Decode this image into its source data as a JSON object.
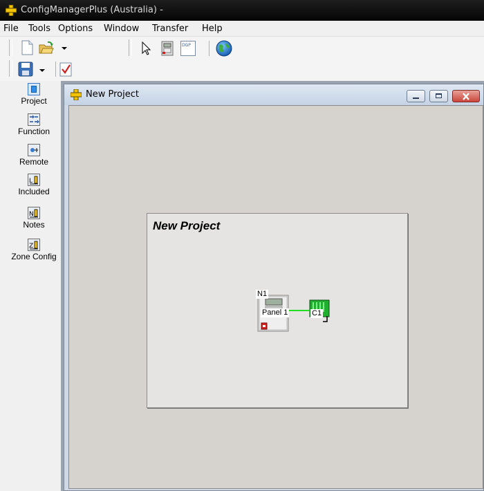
{
  "app": {
    "title": "ConfigManagerPlus (Australia) -"
  },
  "menu": {
    "items": [
      "File",
      "Tools",
      "Options",
      "Window",
      "Transfer",
      "Help"
    ]
  },
  "toolbar": {
    "icons": [
      "new-document-icon",
      "open-folder-icon",
      "save-icon",
      "check-document-icon",
      "pointer-icon",
      "panel-device-icon",
      "dgp-icon",
      "globe-icon"
    ],
    "dgp_label": "DGP"
  },
  "sidebar": {
    "items": [
      {
        "label": "Project",
        "icon": "project-icon"
      },
      {
        "label": "Function",
        "icon": "function-icon"
      },
      {
        "label": "Remote",
        "icon": "remote-icon"
      },
      {
        "label": "Included",
        "icon": "included-icon"
      },
      {
        "label": "Notes",
        "icon": "notes-icon"
      },
      {
        "label": "Zone Config",
        "icon": "zone-config-icon"
      }
    ]
  },
  "child_window": {
    "title": "New Project",
    "buttons": [
      "minimize",
      "maximize",
      "close"
    ]
  },
  "canvas": {
    "project_title": "New Project",
    "nodes": [
      {
        "id_label": "N1",
        "name": "Panel 1"
      },
      {
        "id_label": "C1"
      }
    ]
  },
  "colors": {
    "titlebar": "#0a0a0a",
    "close_button": "#c9463d",
    "link_line": "#22dd22",
    "node_green": "#1fae2e",
    "canvas_bg": "#d6d3ce",
    "panel_bg": "#e5e4e2"
  }
}
